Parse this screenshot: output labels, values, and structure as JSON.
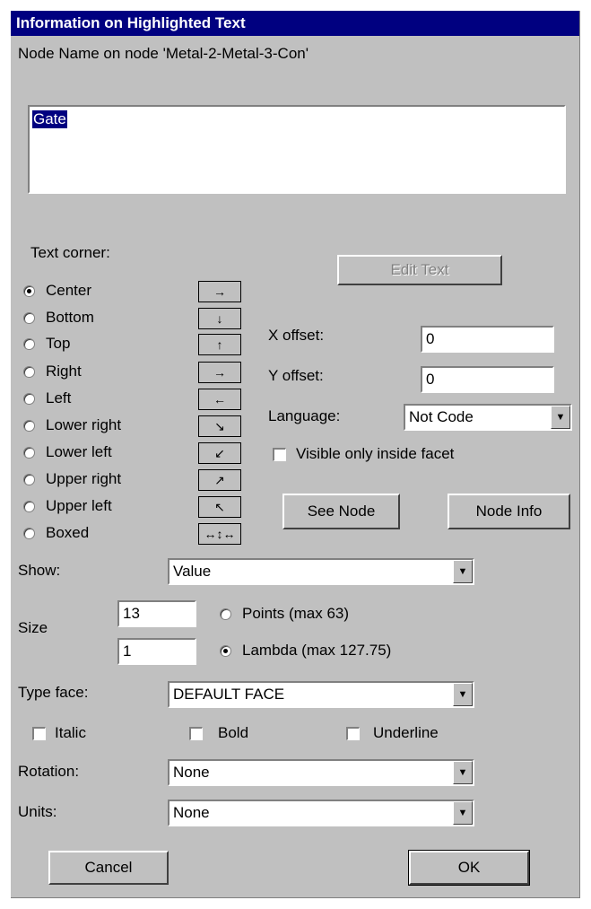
{
  "title": "Information on Highlighted Text",
  "node_name": "Node Name on node 'Metal-2-Metal-3-Con'",
  "text_value": "Gate",
  "text_corner_label": "Text corner:",
  "corners": [
    {
      "label": "Center",
      "selected": true,
      "icon": "→"
    },
    {
      "label": "Bottom",
      "selected": false,
      "icon": "↓"
    },
    {
      "label": "Top",
      "selected": false,
      "icon": "↑"
    },
    {
      "label": "Right",
      "selected": false,
      "icon": "→"
    },
    {
      "label": "Left",
      "selected": false,
      "icon": "←"
    },
    {
      "label": "Lower right",
      "selected": false,
      "icon": "↘"
    },
    {
      "label": "Lower left",
      "selected": false,
      "icon": "↙"
    },
    {
      "label": "Upper right",
      "selected": false,
      "icon": "↗"
    },
    {
      "label": "Upper left",
      "selected": false,
      "icon": "↖"
    },
    {
      "label": "Boxed",
      "selected": false,
      "icon": "↔↕↔"
    }
  ],
  "edit_text_label": "Edit Text",
  "x_offset_label": "X offset:",
  "x_offset_value": "0",
  "y_offset_label": "Y offset:",
  "y_offset_value": "0",
  "language_label": "Language:",
  "language_value": "Not Code",
  "visible_inside_label": "Visible only inside facet",
  "see_node_label": "See Node",
  "node_info_label": "Node Info",
  "show_label": "Show:",
  "show_value": "Value",
  "size_label": "Size",
  "points_value": "13",
  "points_label": "Points (max 63)",
  "lambda_value": "1",
  "lambda_label": "Lambda (max 127.75)",
  "typeface_label": "Type face:",
  "typeface_value": "DEFAULT FACE",
  "italic_label": "Italic",
  "bold_label": "Bold",
  "underline_label": "Underline",
  "rotation_label": "Rotation:",
  "rotation_value": "None",
  "units_label": "Units:",
  "units_value": "None",
  "cancel_label": "Cancel",
  "ok_label": "OK"
}
